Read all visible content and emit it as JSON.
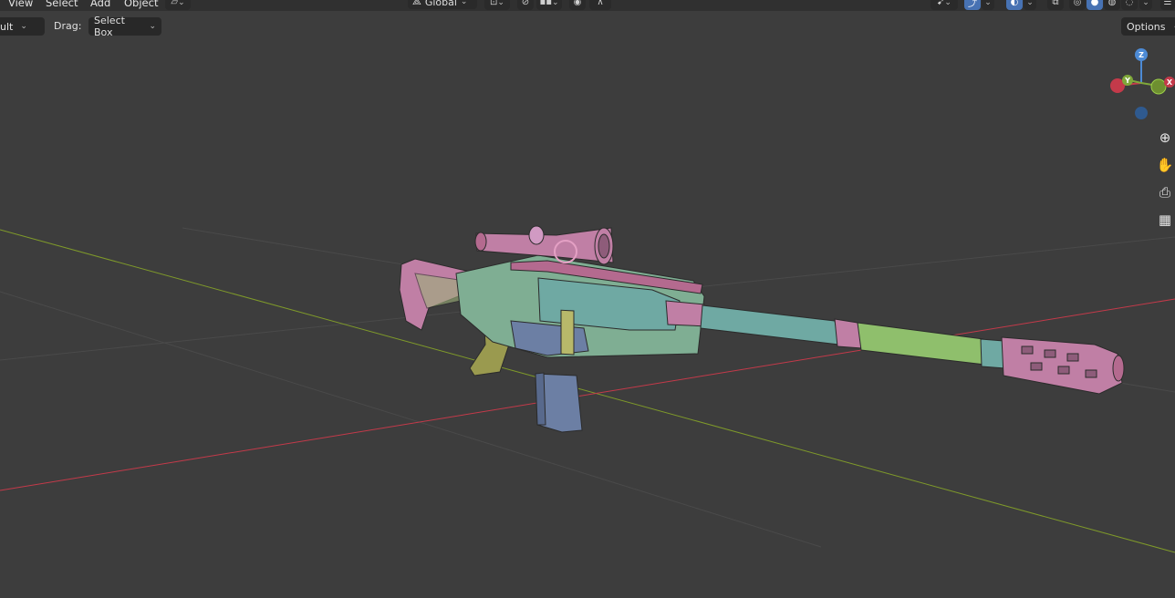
{
  "menu": [
    "View",
    "Select",
    "Add",
    "Object"
  ],
  "top_toolbar": {
    "transform_orientation": "Global",
    "options_label": "Options"
  },
  "tool_header": {
    "mode_value": "ult",
    "drag_label": "Drag:",
    "drag_value": "Select Box"
  },
  "gizmo": {
    "z_label": "Z",
    "y_label": "Y",
    "x_label": "X"
  },
  "nav_icons": [
    "zoom-icon",
    "hand-pan-icon",
    "camera-icon",
    "grid-ortho-icon"
  ],
  "colors": {
    "background": "#3d3d3d",
    "x_axis": "#c43a4a",
    "y_axis": "#7f9a2a",
    "mesh_pink": "#c77fb4",
    "mesh_green": "#8fbf6c",
    "mesh_teal": "#6fa9a3",
    "mesh_blue": "#6c7fa4",
    "active_button": "#4772b3"
  }
}
